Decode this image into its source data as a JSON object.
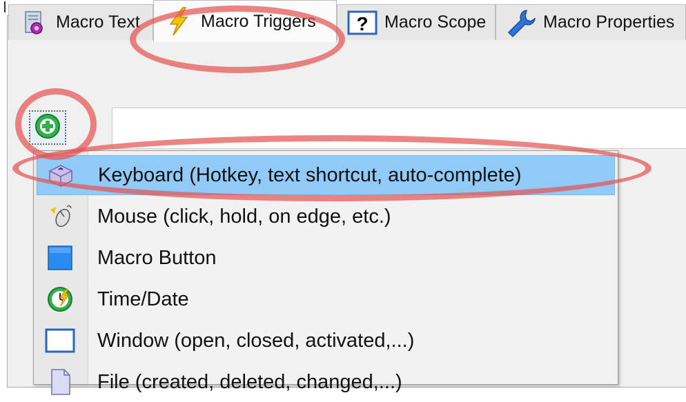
{
  "tabs": [
    {
      "label": "Macro Text",
      "icon": "gear-document-icon",
      "active": false
    },
    {
      "label": "Macro Triggers",
      "icon": "lightning-icon",
      "active": true
    },
    {
      "label": "Macro Scope",
      "icon": "question-mark-icon",
      "active": false
    },
    {
      "label": "Macro Properties",
      "icon": "wrench-icon",
      "active": false
    }
  ],
  "add_button": {
    "icon": "green-plus-icon"
  },
  "trigger_menu": {
    "items": [
      {
        "label": "Keyboard (Hotkey, text shortcut, auto-complete)",
        "icon": "keyboard-key-icon",
        "highlighted": true
      },
      {
        "label": "Mouse (click, hold, on edge, etc.)",
        "icon": "mouse-icon",
        "highlighted": false
      },
      {
        "label": "Macro Button",
        "icon": "blue-square-button-icon",
        "highlighted": false
      },
      {
        "label": "Time/Date",
        "icon": "clock-icon",
        "highlighted": false
      },
      {
        "label": "Window (open, closed, activated,...)",
        "icon": "window-icon",
        "highlighted": false
      },
      {
        "label": "File (created, deleted, changed,...)",
        "icon": "file-icon",
        "highlighted": false
      }
    ]
  },
  "colors": {
    "highlight": "#91c9f7",
    "annotation": "#e65555"
  }
}
